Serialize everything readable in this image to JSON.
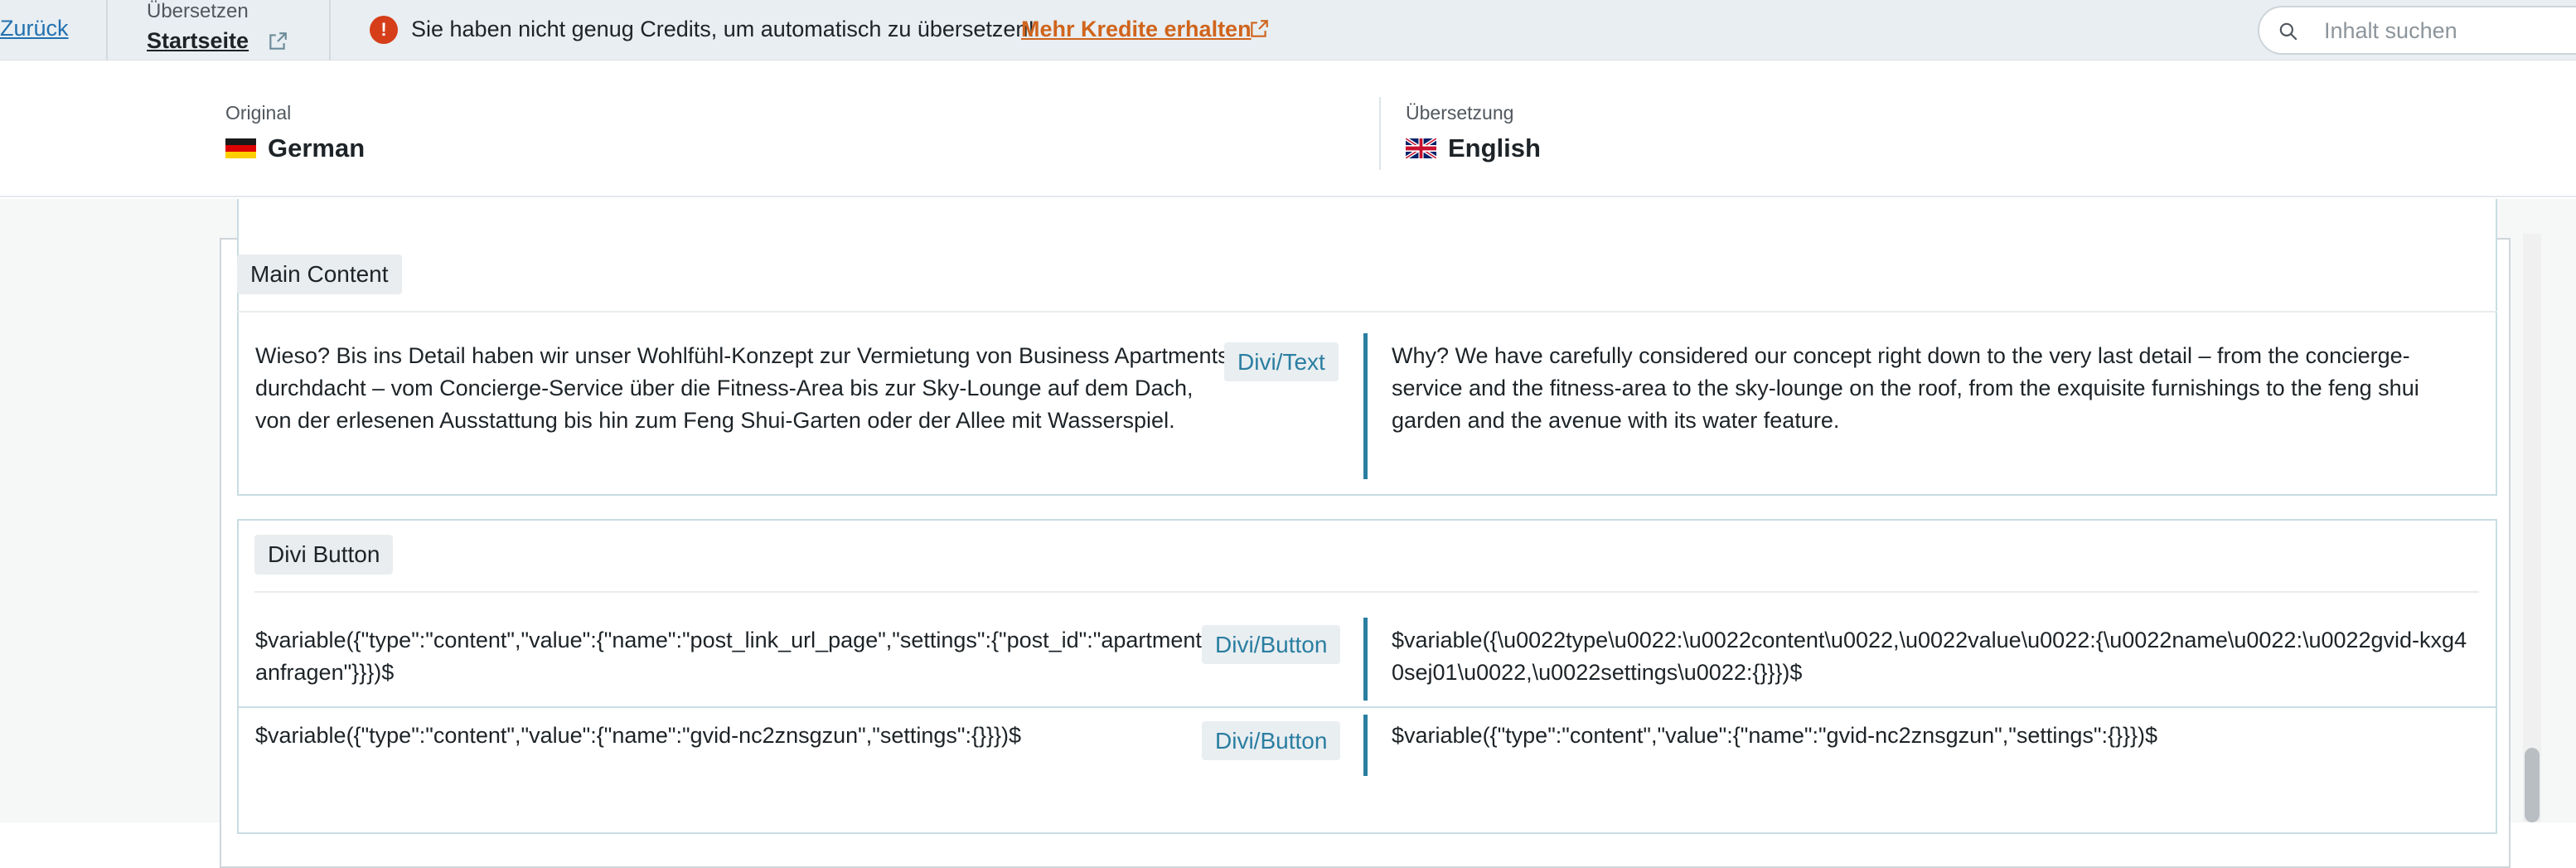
{
  "topbar": {
    "back_label": "Zurück",
    "translate_label": "Übersetzen",
    "page_name": "Startseite",
    "alert_icon": "!",
    "alert_text": "Sie haben nicht genug Credits, um automatisch zu übersetzen!",
    "alert_link": "Mehr Kredite erhalten",
    "search_placeholder": "Inhalt suchen"
  },
  "languages": {
    "original_label": "Original",
    "original_name": "German",
    "translation_label": "Übersetzung",
    "translation_name": "English"
  },
  "groups": [
    {
      "title": "Main Content",
      "rows": [
        {
          "source": "Wieso? Bis ins Detail haben wir unser Wohlfühl-Konzept zur Vermietung von Business Apartments durchdacht – vom Concierge-Service über die Fitness-Area bis zur Sky-Lounge auf dem Dach, von der erlesenen Ausstattung bis hin zum Feng Shui-Garten oder der Allee mit Wasserspiel.",
          "badge": "Divi/Text",
          "target": "Why? We have carefully considered our concept right down to the very last detail – from the concierge-service and the fitness-area to the sky-lounge on the roof, from the exquisite furnishings to the feng shui garden and the avenue with its water feature."
        }
      ]
    },
    {
      "title": "Divi Button",
      "rows": [
        {
          "source": "$variable({\"type\":\"content\",\"value\":{\"name\":\"post_link_url_page\",\"settings\":{\"post_id\":\"apartment-anfragen\"}}})$",
          "badge": "Divi/Button",
          "target": "$variable({\\u0022type\\u0022:\\u0022content\\u0022,\\u0022value\\u0022:{\\u0022name\\u0022:\\u0022gvid-kxg40sej01\\u0022,\\u0022settings\\u0022:{}}})$"
        },
        {
          "source": "$variable({\"type\":\"content\",\"value\":{\"name\":\"gvid-nc2znsgzun\",\"settings\":{}}})$",
          "badge": "Divi/Button",
          "target": "$variable({\"type\":\"content\",\"value\":{\"name\":\"gvid-nc2znsgzun\",\"settings\":{}}})$"
        }
      ]
    }
  ],
  "colors": {
    "accent": "#2a7ea1",
    "alert": "#d63e1a",
    "link_orange": "#d0641c"
  },
  "icons": {
    "external": "external-link-icon",
    "search": "search-icon",
    "alert": "alert-icon",
    "flag_de": "flag-germany-icon",
    "flag_en": "flag-uk-icon"
  }
}
